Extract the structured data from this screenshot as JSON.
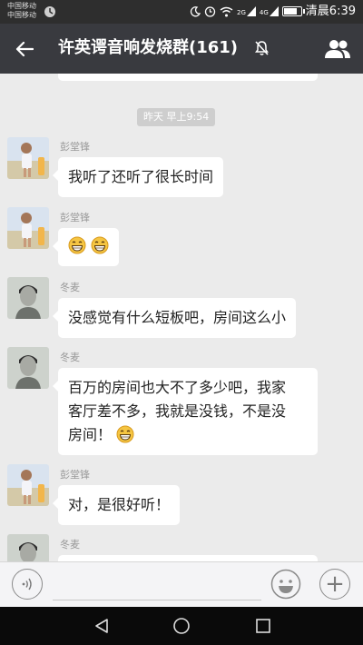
{
  "status_bar": {
    "carrier_1": "中国移动",
    "carrier_2": "中国移动",
    "signal_label_1": "2G",
    "signal_label_2": "4G",
    "time": "清晨6:39"
  },
  "header": {
    "title": "许英谔音响发烧群(161)",
    "back_icon": "arrow-left-icon",
    "mute_icon": "bell-off-icon",
    "members_icon": "people-icon"
  },
  "chat": {
    "timestamp": "昨天 早上9:54",
    "messages": [
      {
        "sender": "彭堂锋",
        "text": "我听了还听了很长时间"
      },
      {
        "sender": "彭堂锋",
        "emoji": "grin-emoji"
      },
      {
        "sender": "冬麦",
        "text": "没感觉有什么短板吧，房间这么小"
      },
      {
        "sender": "冬麦",
        "line1": "百万的房间也大不了多少吧，我家",
        "line2": "客厅差不多，我就是没钱，不是没",
        "line3": "房间！"
      },
      {
        "sender": "彭堂锋",
        "text": "对，是很好听！"
      },
      {
        "sender": "冬麦"
      }
    ]
  },
  "input_bar": {
    "voice_icon": "voice-icon",
    "emoji_icon": "smile-icon",
    "plus_icon": "plus-icon",
    "plus_glyph": "+"
  },
  "nav_bar": {
    "back": "triangle-back-icon",
    "home": "circle-home-icon",
    "recents": "square-recents-icon"
  }
}
